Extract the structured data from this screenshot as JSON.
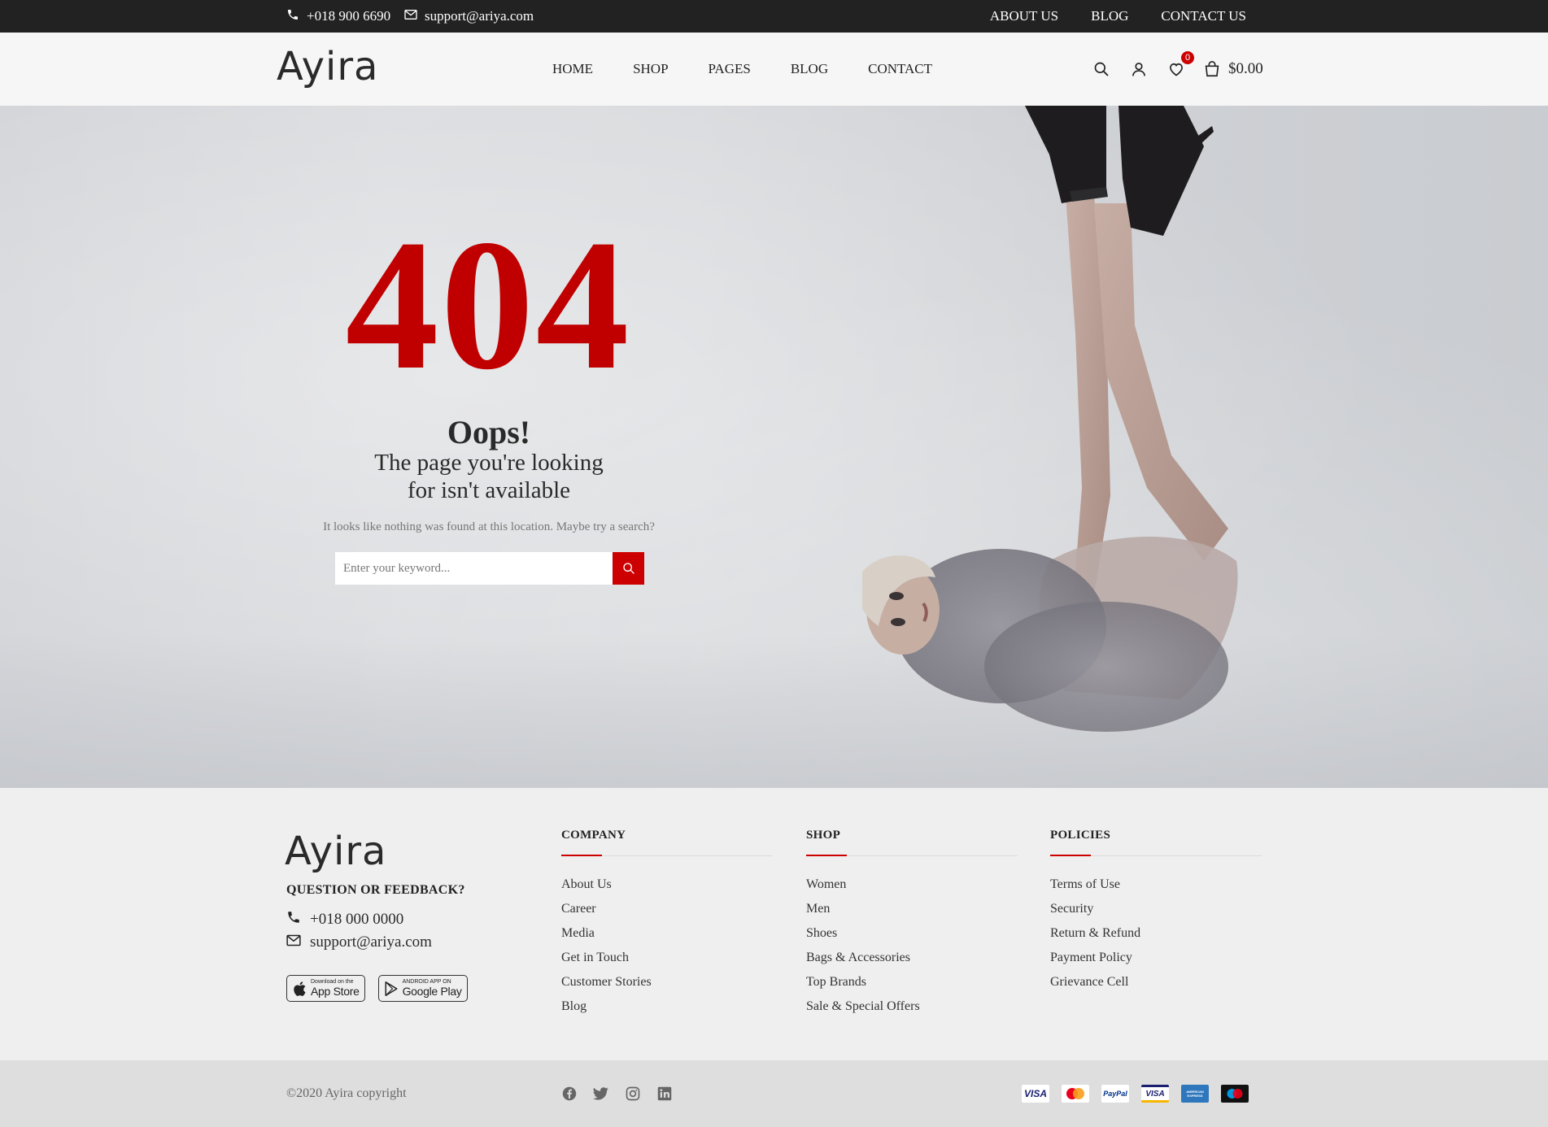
{
  "topbar": {
    "phone": "+018 900 6690",
    "email": "support@ariya.com",
    "links": [
      "ABOUT US",
      "BLOG",
      "CONTACT US"
    ]
  },
  "header": {
    "logo": "Ayira",
    "nav": [
      "HOME",
      "SHOP",
      "PAGES",
      "BLOG",
      "CONTACT"
    ],
    "wishlist_count": "0",
    "cart_total": "$0.00"
  },
  "error": {
    "code": "404",
    "title": "Oops!",
    "message_line1": "The page you're looking",
    "message_line2": "for isn't available",
    "hint": "It looks like nothing was found at this location. Maybe try a search?",
    "search_placeholder": "Enter your keyword..."
  },
  "footer": {
    "logo": "Ayira",
    "feedback_title": "QUESTION OR FEEDBACK?",
    "phone": "+018 000 0000",
    "email": "support@ariya.com",
    "app_store": {
      "small": "Download on the",
      "big": "App Store"
    },
    "google_play": {
      "small": "ANDROID APP ON",
      "big": "Google Play"
    },
    "columns": [
      {
        "title": "COMPANY",
        "items": [
          "About Us",
          "Career",
          "Media",
          "Get in Touch",
          "Customer Stories",
          "Blog"
        ]
      },
      {
        "title": "SHOP",
        "items": [
          "Women",
          "Men",
          "Shoes",
          "Bags & Accessories",
          "Top Brands",
          "Sale & Special Offers"
        ]
      },
      {
        "title": "POLICIES",
        "items": [
          "Terms of Use",
          "Security",
          "Return & Refund",
          "Payment Policy",
          "Grievance Cell"
        ]
      }
    ],
    "copyright": "©2020 Ayira copyright",
    "social_icons": [
      "facebook-icon",
      "twitter-icon",
      "instagram-icon",
      "linkedin-icon"
    ],
    "payments": [
      {
        "name": "visa-icon",
        "label": "VISA"
      },
      {
        "name": "mastercard-icon",
        "label": ""
      },
      {
        "name": "paypal-icon",
        "label": "PayPal"
      },
      {
        "name": "visa-card-icon",
        "label": "VISA"
      },
      {
        "name": "amex-icon",
        "label": "AMERICAN EXPRESS"
      },
      {
        "name": "maestro-icon",
        "label": ""
      }
    ]
  },
  "colors": {
    "accent": "#c00000",
    "topbar_bg": "#222222",
    "footer_bg": "#efefef"
  }
}
